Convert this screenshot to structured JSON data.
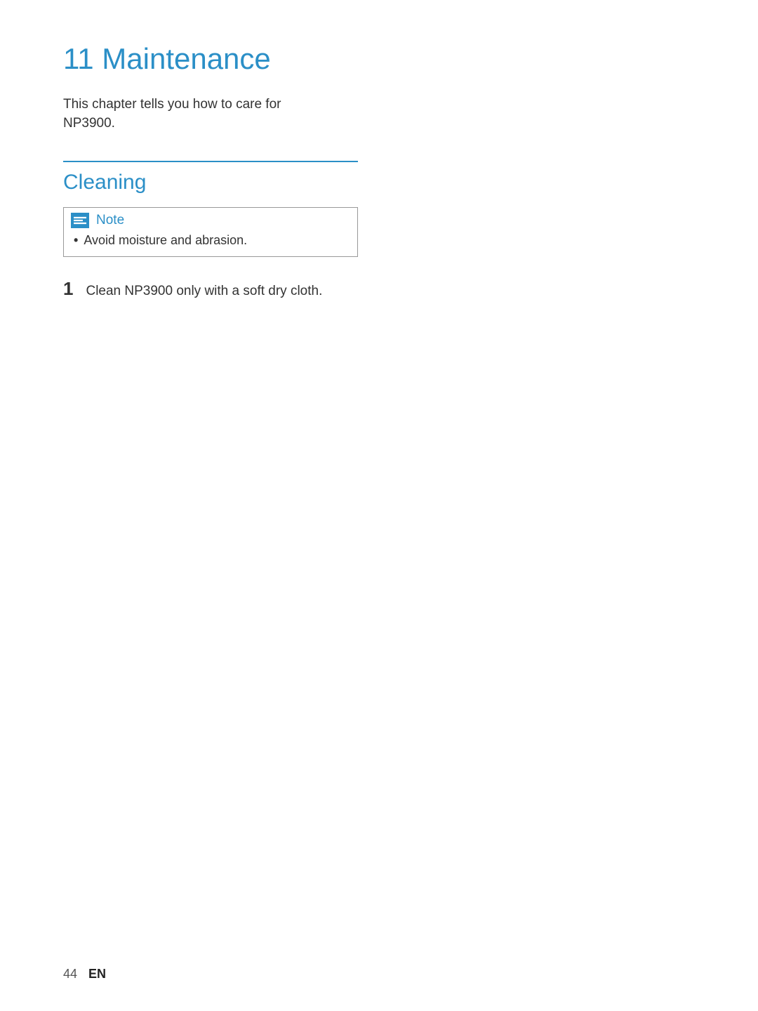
{
  "chapter": {
    "number": "11",
    "title": "Maintenance"
  },
  "intro": "This chapter tells you how to care for NP3900.",
  "section": {
    "title": "Cleaning"
  },
  "note": {
    "label": "Note",
    "items": [
      "Avoid moisture and abrasion."
    ]
  },
  "steps": [
    {
      "num": "1",
      "text": "Clean NP3900 only with a soft dry cloth."
    }
  ],
  "footer": {
    "page": "44",
    "lang": "EN"
  },
  "colors": {
    "accent": "#2b8fc7"
  }
}
